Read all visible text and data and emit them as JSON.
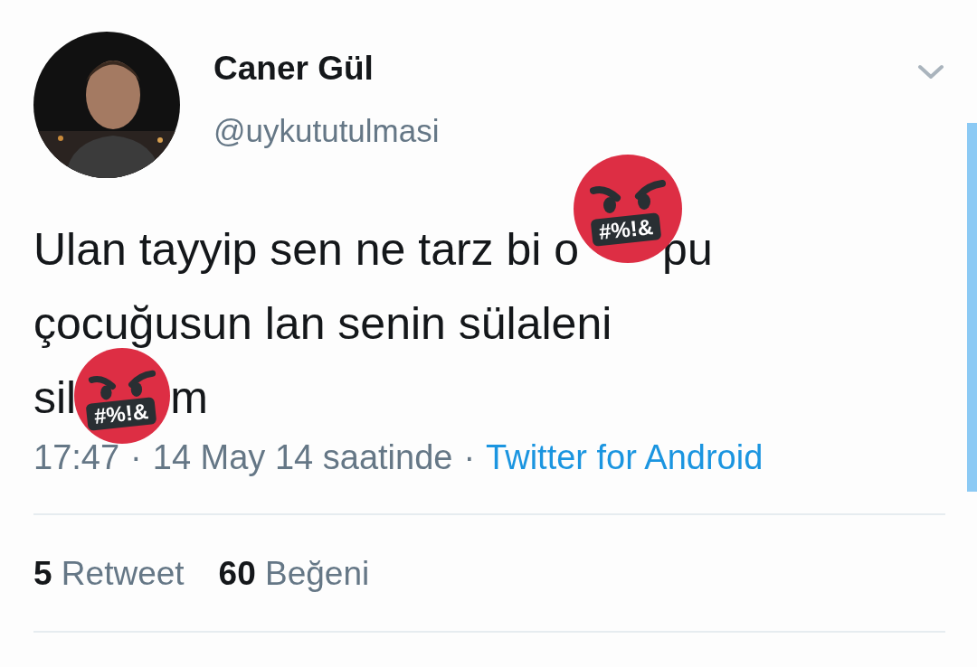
{
  "author": {
    "name": "Caner Gül",
    "handle": "@uykututulmasi"
  },
  "tweet": {
    "lines": [
      [
        {
          "kind": "text",
          "text": "Ulan tayyip sen ne tarz bi o"
        },
        {
          "kind": "sticker",
          "label": "#%!&"
        },
        {
          "kind": "text",
          "text": "pu"
        }
      ],
      [
        {
          "kind": "text",
          "text": "çocuğusun lan senin sülaleni"
        }
      ],
      [
        {
          "kind": "text",
          "text": "sil"
        },
        {
          "kind": "sticker",
          "label": "#%!&"
        },
        {
          "kind": "text",
          "text": "m"
        }
      ]
    ]
  },
  "meta": {
    "time": "17:47",
    "separator": "·",
    "date": "14 May 14 saatinde",
    "separator_2": "·",
    "source": "Twitter for Android"
  },
  "stats": [
    {
      "count": "5",
      "label": "Retweet"
    },
    {
      "count": "60",
      "label": "Beğeni"
    }
  ]
}
